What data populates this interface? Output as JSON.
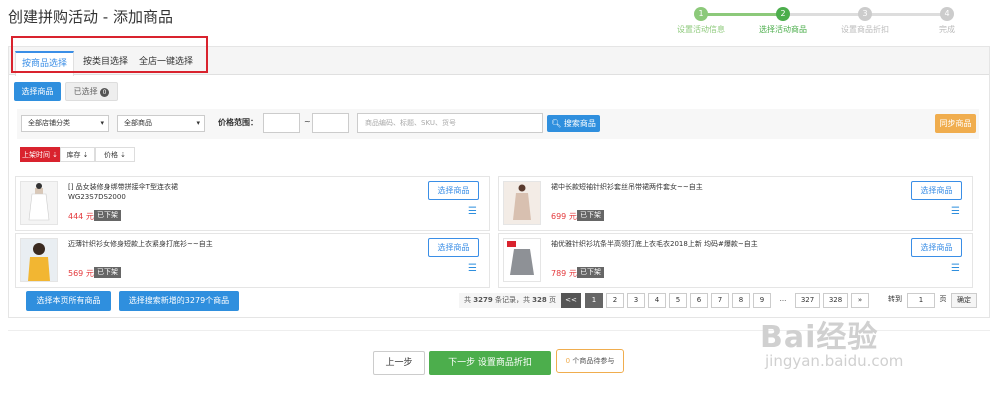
{
  "title": "创建拼购活动 - 添加商品",
  "steps": [
    {
      "n": "1",
      "label": "设置活动信息",
      "state": "done"
    },
    {
      "n": "2",
      "label": "选择活动商品",
      "state": "current"
    },
    {
      "n": "3",
      "label": "设置商品折扣",
      "state": "todo"
    },
    {
      "n": "4",
      "label": "完成",
      "state": "todo"
    }
  ],
  "tabs": [
    "按商品选择",
    "按类目选择",
    "全店一键选择"
  ],
  "subtabs": {
    "selectable": "选择商品",
    "selected": "已选择",
    "selected_count": "0"
  },
  "filters": {
    "shop_category": "全部店铺分类",
    "goods_scope": "全部商品",
    "price_label": "价格范围：",
    "dash": "~",
    "search_placeholder": "商品编码、标题、SKU、货号",
    "search_btn": "搜索商品",
    "sync_btn": "同步商品"
  },
  "sorts": [
    "上架时间 ⇣",
    "库存 ⇣",
    "价格 ⇣"
  ],
  "products": [
    {
      "name": "[] 品女装修身绑带拼接伞T型连衣裙",
      "sku": "WG23S7DS2000",
      "price": "444 元",
      "status": "已下架",
      "pick": "选择商品"
    },
    {
      "name": "裙中长款短袖针织衫套丝吊带裙两件套女~~自主",
      "sku": "",
      "price": "699 元",
      "status": "已下架",
      "pick": "选择商品"
    },
    {
      "name": "迈薄针织衫女修身短款上衣紧身打底衫~~自主",
      "sku": "",
      "price": "569 元",
      "status": "已下架",
      "pick": "选择商品"
    },
    {
      "name": "袖优雅针织衫坑条半高领打底上衣毛衣2018上新 均码#爆款~自主",
      "sku": "",
      "price": "789 元",
      "status": "已下架",
      "pick": "选择商品"
    }
  ],
  "footer": {
    "select_page": "选择本页所有商品",
    "select_search": "选择搜索新增的3279个商品",
    "info_prefix": "共 ",
    "total": "3279",
    "info_mid": " 条记录，共 ",
    "pages": "328",
    "info_suffix": " 页"
  },
  "pager": [
    "<<",
    "1",
    "2",
    "3",
    "4",
    "5",
    "6",
    "7",
    "8",
    "9",
    "...",
    "327",
    "328",
    "»"
  ],
  "goto": {
    "label": "转到",
    "value": "1",
    "unit": "页",
    "confirm": "确定"
  },
  "bottom": {
    "prev": "上一步",
    "next": "下一步 设置商品折扣",
    "pending_count": "0",
    "pending_text": " 个商品待参与"
  },
  "watermark": {
    "logo": "Bai经验",
    "url": "jingyan.baidu.com"
  },
  "colors": {
    "primary": "#2f8fde",
    "success": "#4cae4c",
    "danger": "#e4393c",
    "orange": "#f0ad4e",
    "highlight": "#d9232e"
  }
}
